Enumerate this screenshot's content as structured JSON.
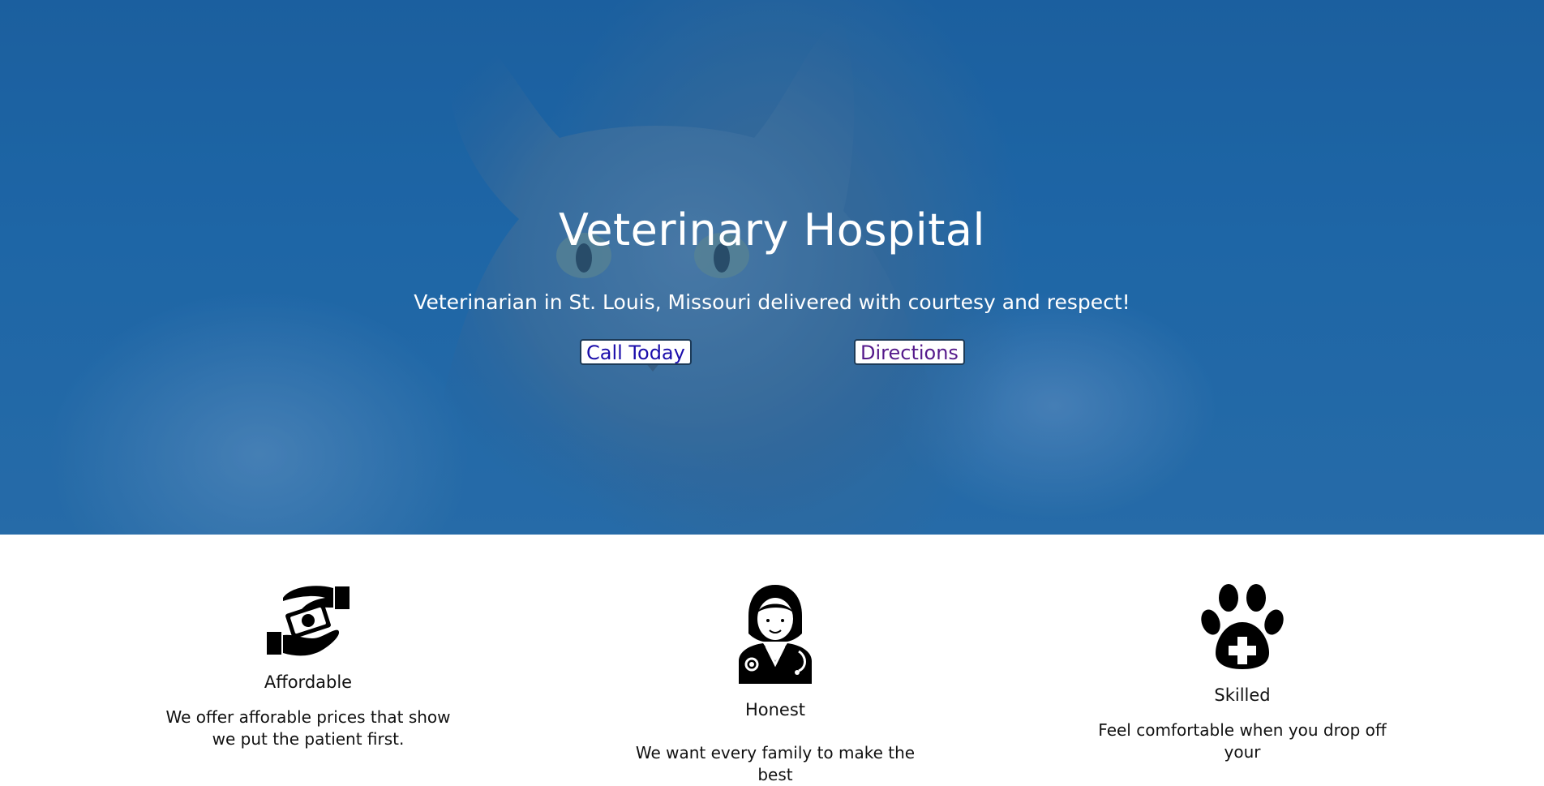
{
  "hero": {
    "title": "Veterinary Hospital",
    "subtitle": "Veterinarian in St. Louis, Missouri delivered with courtesy and respect!",
    "call_label": "Call Today",
    "directions_label": "Directions"
  },
  "features": [
    {
      "icon": "hand-money-icon",
      "title": "Affordable",
      "text": "We offer afforable prices that show we put the patient first."
    },
    {
      "icon": "doctor-icon",
      "title": "Honest",
      "text": "We want every family to make the best"
    },
    {
      "icon": "paw-cross-icon",
      "title": "Skilled",
      "text": "Feel comfortable when you drop off your"
    }
  ],
  "colors": {
    "hero_blue": "#1f67a6",
    "call_link": "#1a0dab",
    "directions_link": "#551a8b"
  }
}
